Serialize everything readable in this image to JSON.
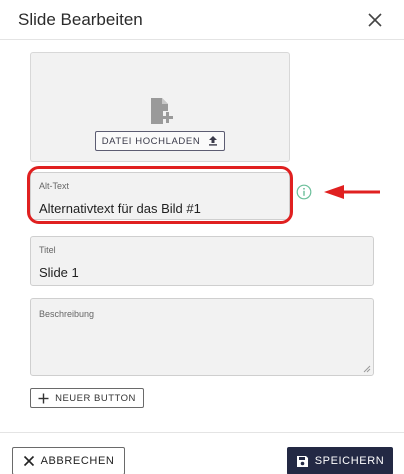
{
  "dialog": {
    "title": "Slide Bearbeiten",
    "close_icon": "close-icon"
  },
  "upload": {
    "file_icon": "file-add-icon",
    "button_label": "DATEI HOCHLADEN",
    "button_icon": "upload-icon"
  },
  "alt_text": {
    "label": "Alt-Text",
    "value": "Alternativtext für das Bild #1",
    "info_icon": "info-icon",
    "highlight_color": "#e02020"
  },
  "title_field": {
    "label": "Titel",
    "value": "Slide 1"
  },
  "description_field": {
    "label": "Beschreibung",
    "value": ""
  },
  "new_button": {
    "label": "NEUER BUTTON",
    "icon": "plus-icon"
  },
  "footer": {
    "cancel_label": "ABBRECHEN",
    "cancel_icon": "close-icon",
    "save_label": "SPEICHERN",
    "save_icon": "save-icon",
    "save_color": "#232944"
  }
}
